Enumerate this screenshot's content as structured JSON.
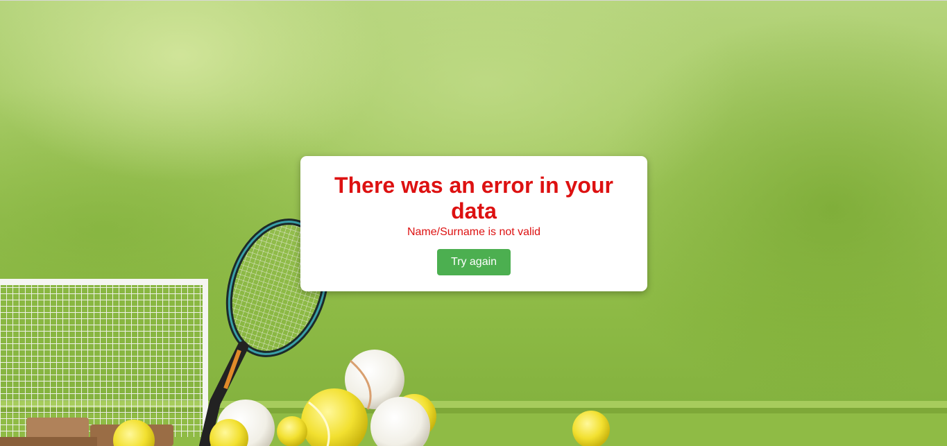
{
  "dialog": {
    "title": "There was an error in your data",
    "message": "Name/Surname is not valid",
    "button_label": "Try again"
  },
  "colors": {
    "error_text": "#dd1111",
    "button_background": "#4caf50",
    "button_text": "#ffffff",
    "dialog_background": "#ffffff",
    "page_background": "#9fc65a"
  },
  "icons": {
    "background_scene": "tennis-scene-illustration"
  }
}
